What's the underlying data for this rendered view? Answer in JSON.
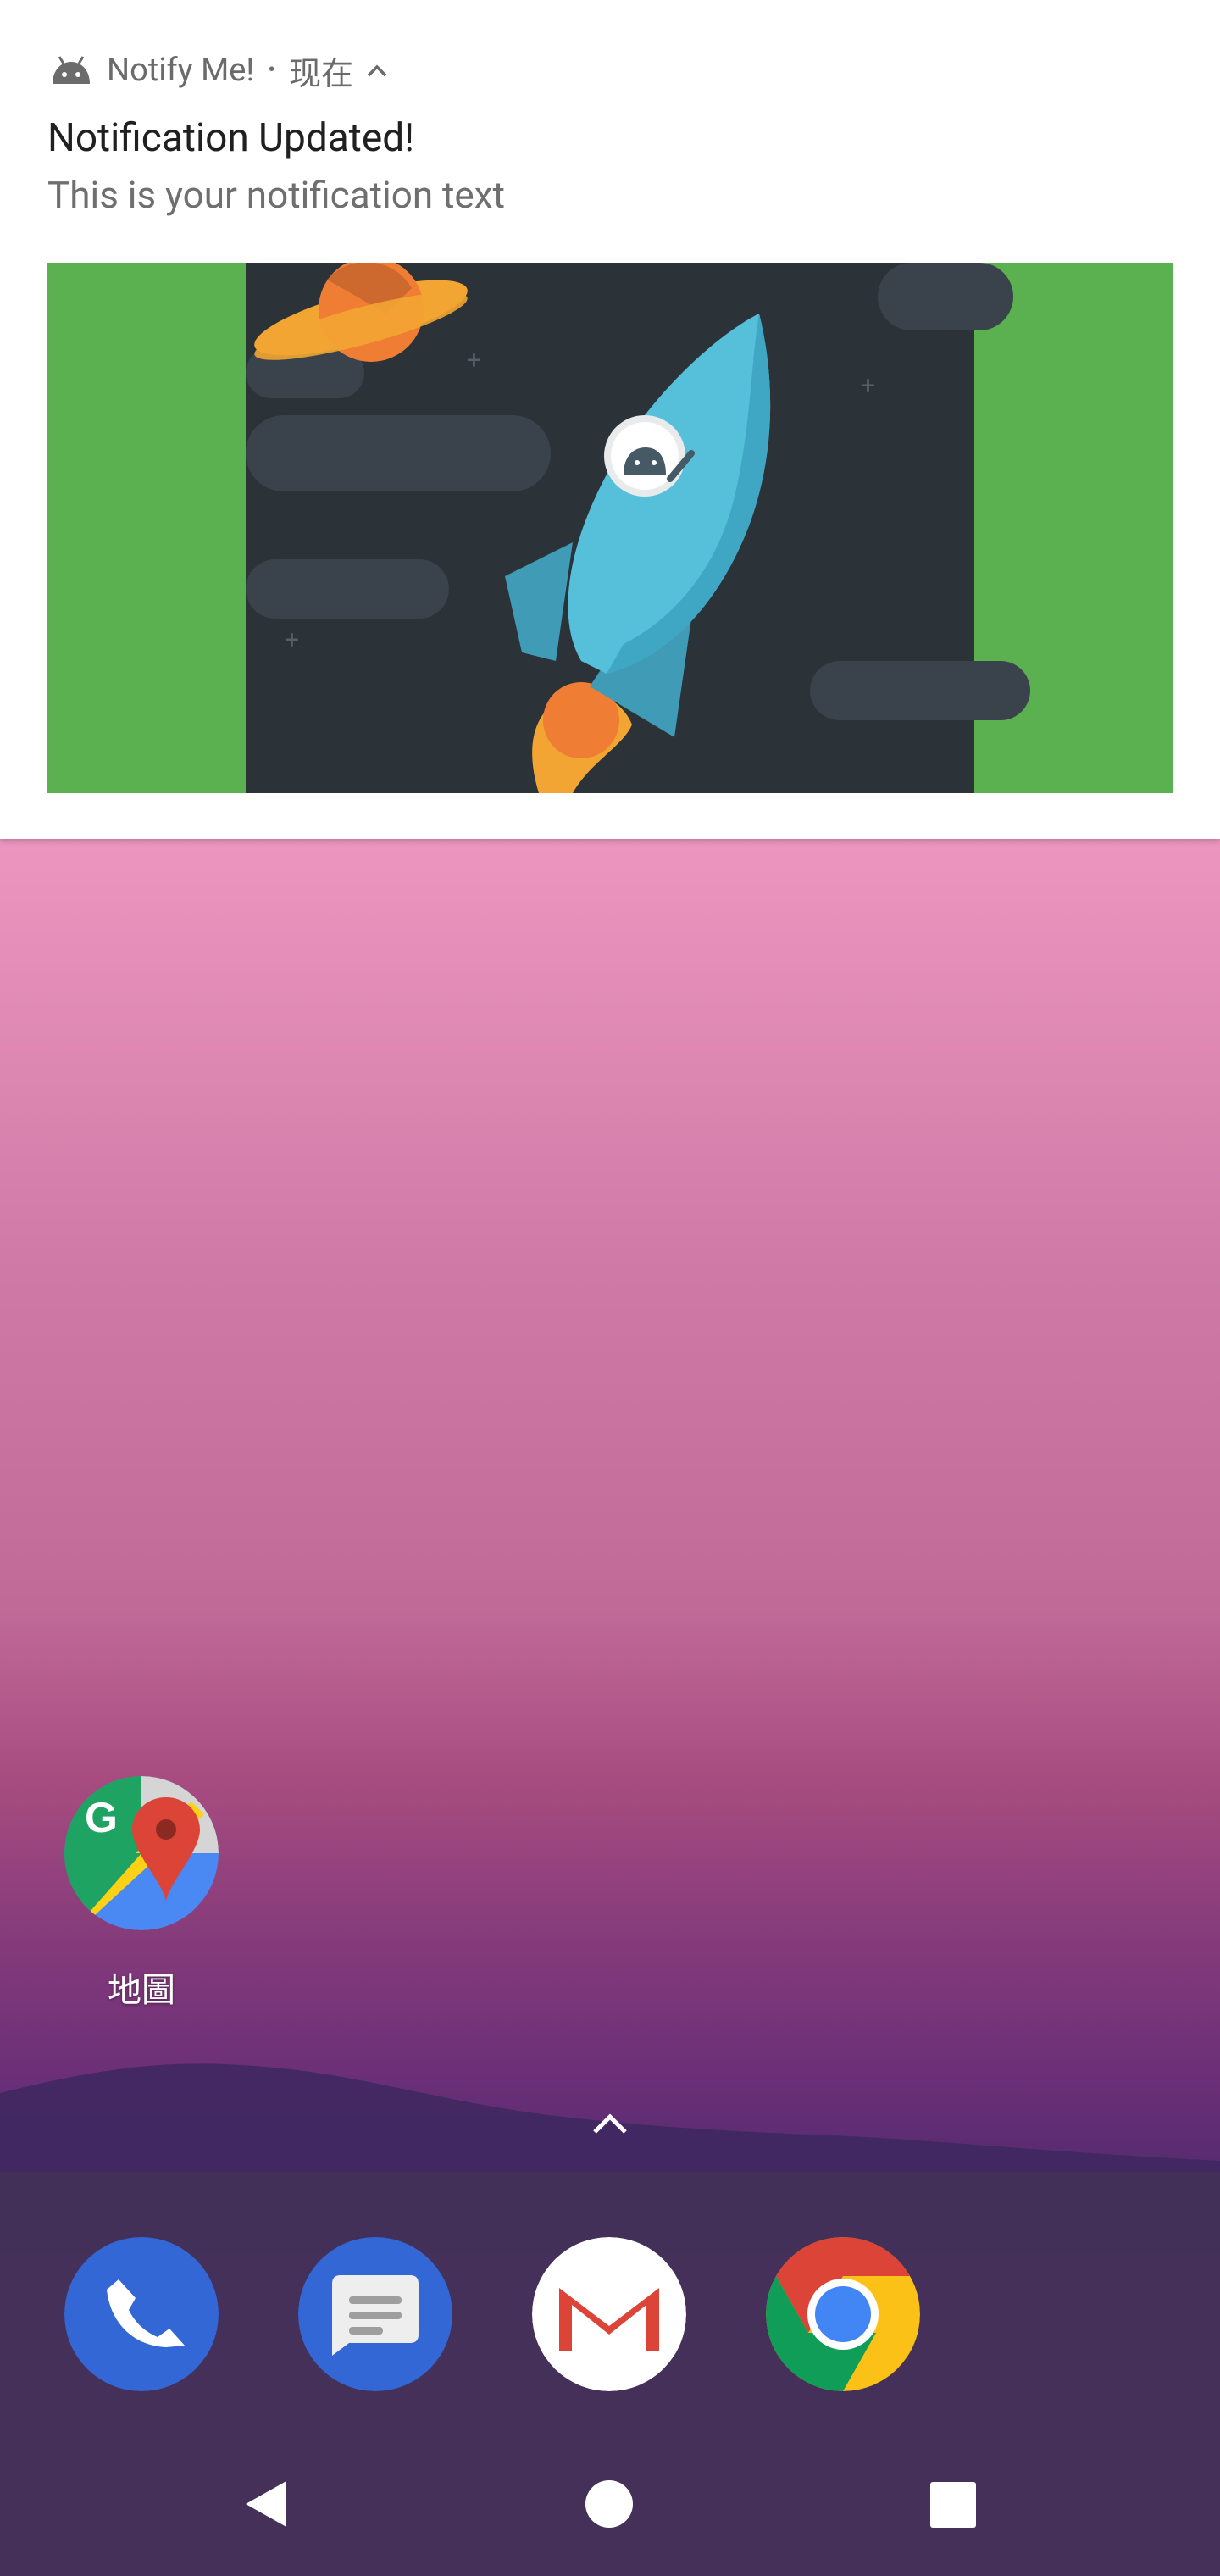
{
  "notification": {
    "app_name": "Notify Me!",
    "separator": "•",
    "time": "现在",
    "title": "Notification Updated!",
    "text": "This is your notification text",
    "app_icon": "android-icon",
    "expand_icon": "chevron-up-icon",
    "image_description_icon": "rocket-image"
  },
  "home": {
    "apps": [
      {
        "label": "地圖",
        "icon": "google-maps-icon"
      }
    ],
    "all_apps_icon": "chevron-up-icon"
  },
  "dock": {
    "apps": [
      {
        "icon": "phone-icon"
      },
      {
        "icon": "messages-icon"
      },
      {
        "icon": "gmail-icon"
      },
      {
        "icon": "chrome-icon"
      }
    ]
  },
  "navbar": {
    "back_icon": "back-triangle-icon",
    "home_icon": "home-circle-icon",
    "recents_icon": "recents-square-icon"
  },
  "colors": {
    "notif_bg": "#ffffff",
    "image_green": "#5bb050",
    "image_space": "#2b3238",
    "rocket_blue": "#56bfd9",
    "dock_band": "#433158"
  }
}
